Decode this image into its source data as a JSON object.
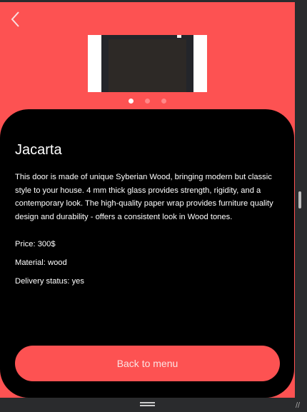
{
  "colors": {
    "accent": "#fd5252",
    "card": "#000000"
  },
  "header": {
    "back_icon": "chevron-left-icon"
  },
  "gallery": {
    "pages": 3,
    "active_index": 0
  },
  "product": {
    "title": "Jacarta",
    "description": "This door is made of unique Syberian Wood, bringing modern but classic style to your house. 4 mm thick glass provides strength, rigidity, and a contemporary look. The high-quality paper wrap provides furniture quality design and durability - offers a consistent look in Wood tones.",
    "price": "Price: 300$",
    "material": "Material: wood",
    "delivery": "Delivery status: yes"
  },
  "actions": {
    "back_to_menu": "Back to menu"
  }
}
